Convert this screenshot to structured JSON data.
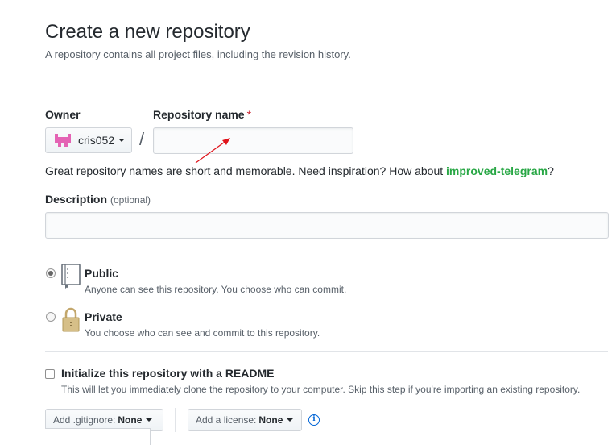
{
  "header": {
    "title": "Create a new repository",
    "subtitle": "A repository contains all project files, including the revision history."
  },
  "owner": {
    "label": "Owner",
    "value": "cris052"
  },
  "separator": "/",
  "repo_name": {
    "label": "Repository name",
    "required_mark": "*",
    "value": "",
    "placeholder": ""
  },
  "hint": {
    "text": "Great repository names are short and memorable. Need inspiration? How about ",
    "suggestion": "improved-telegram",
    "end": "?"
  },
  "description": {
    "label": "Description",
    "optional": "(optional)",
    "value": "",
    "placeholder": ""
  },
  "visibility": {
    "public": {
      "title": "Public",
      "desc": "Anyone can see this repository. You choose who can commit.",
      "checked": true
    },
    "private": {
      "title": "Private",
      "desc": "You choose who can see and commit to this repository.",
      "checked": false
    }
  },
  "readme": {
    "label": "Initialize this repository with a README",
    "desc": "This will let you immediately clone the repository to your computer. Skip this step if you're importing an existing repository.",
    "checked": false
  },
  "gitignore": {
    "label": "Add .gitignore:",
    "value": "None"
  },
  "license": {
    "label": "Add a license:",
    "value": "None"
  },
  "colors": {
    "accent_link": "#0366d6",
    "suggestion": "#28a745",
    "required": "#cb2431",
    "annotation_arrow": "#e0131b",
    "avatar": "#e463b4"
  },
  "icons": [
    "avatar-identicon",
    "caret-down-icon",
    "repo-icon",
    "lock-icon",
    "info-icon"
  ]
}
